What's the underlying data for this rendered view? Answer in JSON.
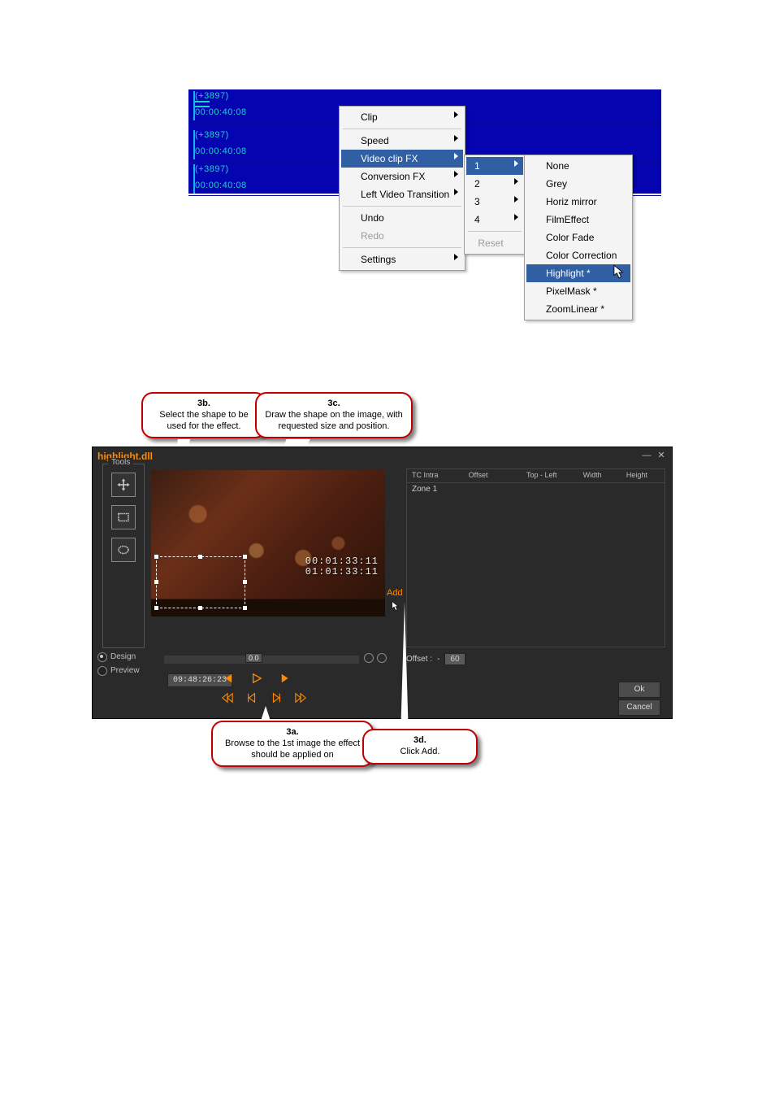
{
  "timeline": {
    "rows": [
      {
        "id": "(+3897)",
        "time": "00:00:40:08"
      },
      {
        "id": "(+3897)",
        "time": "00:00:40:08"
      },
      {
        "id": "(+3897)",
        "time": "00:00:40:08"
      }
    ]
  },
  "menu1": {
    "items": [
      {
        "label": "Clip",
        "arrow": true
      },
      {
        "label": "Speed",
        "arrow": true
      },
      {
        "label": "Video clip FX",
        "arrow": true,
        "selected": true
      },
      {
        "label": "Conversion FX",
        "arrow": true
      },
      {
        "label": "Left Video Transition",
        "arrow": true
      },
      {
        "sep": true
      },
      {
        "label": "Undo"
      },
      {
        "label": "Redo",
        "disabled": true
      },
      {
        "sep": true
      },
      {
        "label": "Settings",
        "arrow": true
      }
    ]
  },
  "menu2": {
    "items": [
      {
        "label": "1",
        "arrow": true,
        "selected": true
      },
      {
        "label": "2",
        "arrow": true
      },
      {
        "label": "3",
        "arrow": true
      },
      {
        "label": "4",
        "arrow": true
      },
      {
        "sep": true
      },
      {
        "label": "Reset",
        "disabled": true
      }
    ]
  },
  "menu3": {
    "items": [
      {
        "label": "None"
      },
      {
        "label": "Grey"
      },
      {
        "label": "Horiz mirror"
      },
      {
        "label": "FilmEffect"
      },
      {
        "label": "Color Fade"
      },
      {
        "label": "Color Correction"
      },
      {
        "label": "Highlight *",
        "selected": true
      },
      {
        "label": "PixelMask *"
      },
      {
        "label": "ZoomLinear *"
      }
    ]
  },
  "callouts": {
    "c3b": {
      "title": "3b.",
      "text": "Select the shape to be used for the effect."
    },
    "c3c": {
      "title": "3c.",
      "text": "Draw the shape on the image, with requested size and position."
    },
    "c3a": {
      "title": "3a.",
      "text": "Browse to the 1st image the effect should be applied on"
    },
    "c3d": {
      "title": "3d.",
      "text": "Click Add."
    }
  },
  "fx": {
    "title": "highlight.dll",
    "tools_label": "Tools",
    "add_label": "Add",
    "timecode_overlay1": "00:01:33:11",
    "timecode_overlay2": "01:01:33:11",
    "mode_design": "Design",
    "mode_preview": "Preview",
    "scrub_pos": "0.0",
    "timecode_input": "09:48:26:23",
    "table": {
      "headers": {
        "c1": "TC Intra",
        "c2": "Offset",
        "c3": "Top - Left",
        "c4": "Width",
        "c5": "Height"
      },
      "row1": "Zone 1"
    },
    "offset_label": "Offset :",
    "offset_minus": "-",
    "offset_value": "60",
    "btn_ok": "Ok",
    "btn_cancel": "Cancel"
  }
}
